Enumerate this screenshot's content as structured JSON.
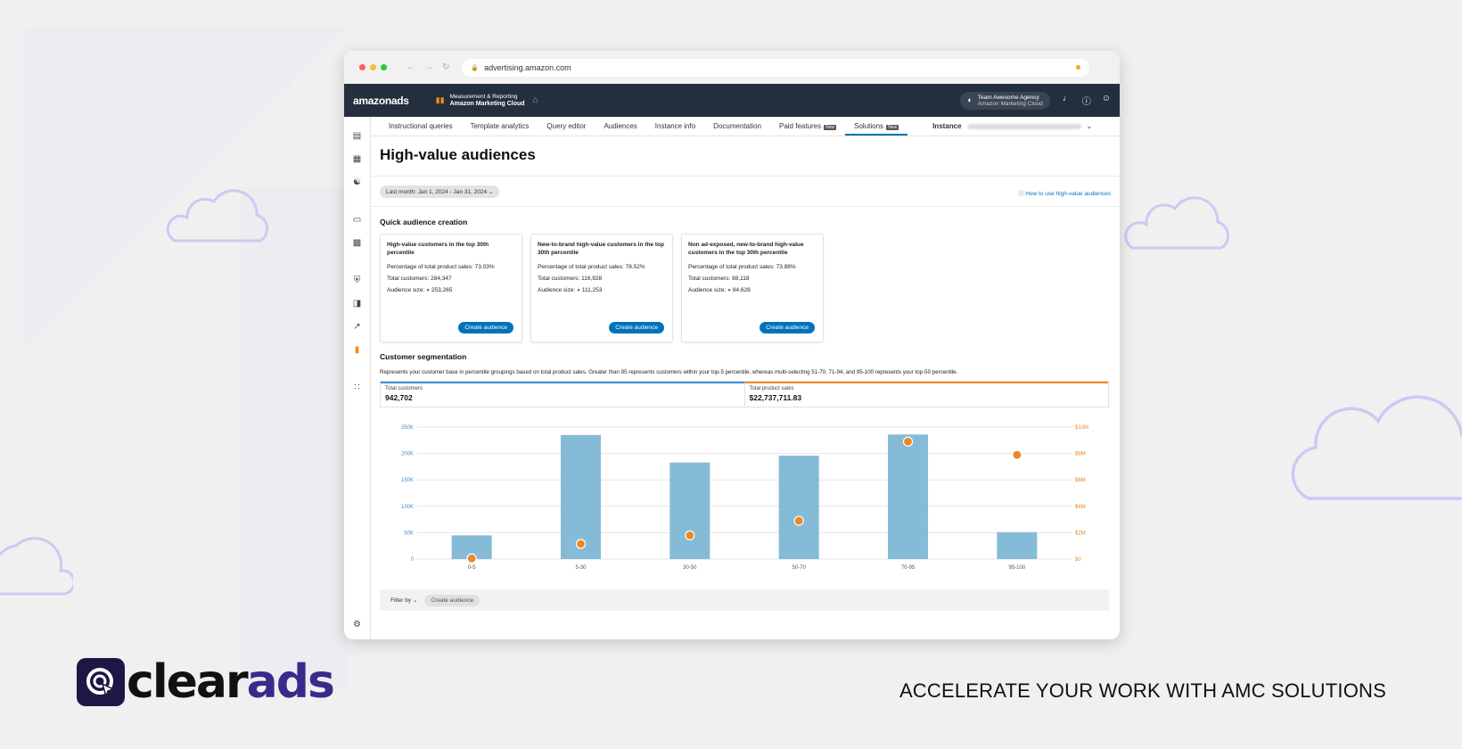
{
  "browser": {
    "url": "advertising.amazon.com"
  },
  "topbar": {
    "brand": "amazonads",
    "product_line1": "Measurement & Reporting",
    "product_line2": "Amazon Marketing Cloud",
    "account_line1": "Team Awesome Agency",
    "account_line2": "Amazon Marketing Cloud"
  },
  "tabs": [
    {
      "label": "Instructional queries"
    },
    {
      "label": "Template analytics"
    },
    {
      "label": "Query editor"
    },
    {
      "label": "Audiences"
    },
    {
      "label": "Instance info"
    },
    {
      "label": "Documentation"
    },
    {
      "label": "Paid features",
      "tag": "New"
    },
    {
      "label": "Solutions",
      "tag": "New",
      "active": true
    }
  ],
  "instance_label": "Instance",
  "page_title": "High-value audiences",
  "date_range": "Last month: Jan 1, 2024 - Jan 31, 2024",
  "help_link": "How to use high-value audiences",
  "quick": {
    "title": "Quick audience creation",
    "cards": [
      {
        "title": "High-value customers in the top 30th percentile",
        "pct_label": "Percentage of total product sales:",
        "pct": "73.03%",
        "cust_label": "Total customers:",
        "cust": "284,347",
        "size_label": "Audience size:",
        "size": "253,265",
        "button": "Create audience"
      },
      {
        "title": "New-to-brand high-value customers in the top 30th percentile",
        "pct_label": "Percentage of total product sales:",
        "pct": "78.52%",
        "cust_label": "Total customers:",
        "cust": "116,928",
        "size_label": "Audience size:",
        "size": "111,253",
        "button": "Create audience"
      },
      {
        "title": "Non ad-exposed, new-to-brand high-value customers in the top 30th percentile",
        "pct_label": "Percentage of total product sales:",
        "pct": "73.88%",
        "cust_label": "Total customers:",
        "cust": "88,118",
        "size_label": "Audience size:",
        "size": "84,628",
        "button": "Create audience"
      }
    ]
  },
  "segmentation": {
    "title": "Customer segmentation",
    "description": "Represents your customer base in percentile groupings based on total product sales. Greater than 95 represents customers within your top-5 percentile, whereas multi-selecting 51-70, 71-94, and 95-100 represents your top-50 percentile.",
    "total_customers_label": "Total customers",
    "total_customers": "942,702",
    "total_sales_label": "Total product sales",
    "total_sales": "$22,737,711.83"
  },
  "chart_data": {
    "type": "bar",
    "categories": [
      "0-5",
      "5-30",
      "30-50",
      "50-70",
      "70-95",
      "95-100"
    ],
    "series": [
      {
        "values": [
          45000,
          235000,
          183000,
          196000,
          236000,
          51000
        ],
        "color": "#86bbd8",
        "axis": "left"
      },
      {
        "values": [
          0.05,
          1.15,
          1.8,
          2.9,
          8.9,
          7.9
        ],
        "color": "#e8892b",
        "axis": "right",
        "kind": "point"
      }
    ],
    "y_left_ticks": [
      "250K",
      "200K",
      "150K",
      "100K",
      "50K",
      "0"
    ],
    "y_right_ticks": [
      "$10M",
      "$8M",
      "$6M",
      "$4M",
      "$2M",
      "$0"
    ],
    "ylim_left": [
      0,
      250000
    ],
    "ylim_right": [
      0,
      10
    ],
    "grid": true
  },
  "filter": {
    "label": "Filter by",
    "chip": "Create audience"
  },
  "footer": {
    "logo_left": "clear",
    "logo_right": "ads",
    "tagline": "ACCELERATE YOUR WORK WITH AMC SOLUTIONS"
  },
  "colors": {
    "nav_bg": "#232f3e",
    "primary": "#0073bb",
    "orange": "#f08c1a",
    "logo": "#1f1646"
  }
}
